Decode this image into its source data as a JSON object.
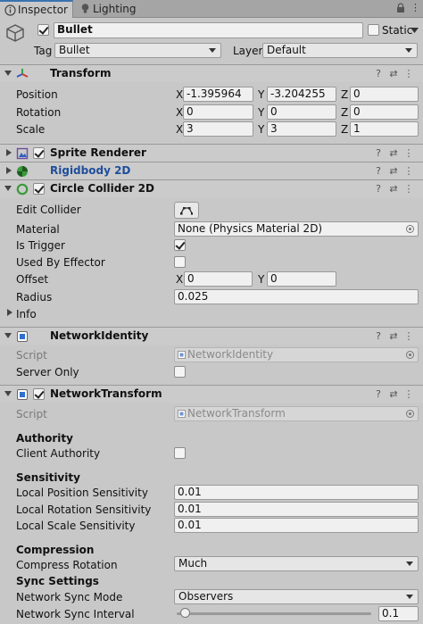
{
  "tabs": [
    {
      "label": "Inspector",
      "icon": "info-icon"
    },
    {
      "label": "Lighting",
      "icon": "bulb-icon"
    }
  ],
  "object": {
    "name": "Bullet",
    "static_label": "Static",
    "tag_label": "Tag",
    "tag_value": "Bullet",
    "layer_label": "Layer",
    "layer_value": "Default"
  },
  "transform": {
    "title": "Transform",
    "position_label": "Position",
    "rotation_label": "Rotation",
    "scale_label": "Scale",
    "axis_x": "X",
    "axis_y": "Y",
    "axis_z": "Z",
    "position": {
      "x": "-1.395964",
      "y": "-3.204255",
      "z": "0"
    },
    "rotation": {
      "x": "0",
      "y": "0",
      "z": "0"
    },
    "scale": {
      "x": "3",
      "y": "3",
      "z": "1"
    }
  },
  "sprite_renderer": {
    "title": "Sprite Renderer"
  },
  "rigidbody": {
    "title": "Rigidbody 2D"
  },
  "circle_collider": {
    "title": "Circle Collider 2D",
    "edit_collider_label": "Edit Collider",
    "material_label": "Material",
    "material_value": "None (Physics Material 2D)",
    "is_trigger_label": "Is Trigger",
    "used_by_effector_label": "Used By Effector",
    "offset_label": "Offset",
    "offset": {
      "x": "0",
      "y": "0"
    },
    "radius_label": "Radius",
    "radius_value": "0.025",
    "info_label": "Info"
  },
  "network_identity": {
    "title": "NetworkIdentity",
    "script_label": "Script",
    "script_value": "NetworkIdentity",
    "server_only_label": "Server Only"
  },
  "network_transform": {
    "title": "NetworkTransform",
    "script_label": "Script",
    "script_value": "NetworkTransform",
    "authority_heading": "Authority",
    "client_authority_label": "Client Authority",
    "sensitivity_heading": "Sensitivity",
    "local_position_sensitivity_label": "Local Position Sensitivity",
    "local_position_sensitivity_value": "0.01",
    "local_rotation_sensitivity_label": "Local Rotation Sensitivity",
    "local_rotation_sensitivity_value": "0.01",
    "local_scale_sensitivity_label": "Local Scale Sensitivity",
    "local_scale_sensitivity_value": "0.01",
    "compression_heading": "Compression",
    "compress_rotation_label": "Compress Rotation",
    "compress_rotation_value": "Much",
    "sync_settings_heading": "Sync Settings",
    "network_sync_mode_label": "Network Sync Mode",
    "network_sync_mode_value": "Observers",
    "network_sync_interval_label": "Network Sync Interval",
    "network_sync_interval_value": "0.1",
    "network_sync_interval_fraction": 0.04
  },
  "colors": {
    "active_tab_accent": "#3a72b0",
    "rigidbody_title": "#1f4e9c",
    "transform_icon_red": "#d23a2c",
    "collider_icon_green": "#3a9a3a"
  }
}
